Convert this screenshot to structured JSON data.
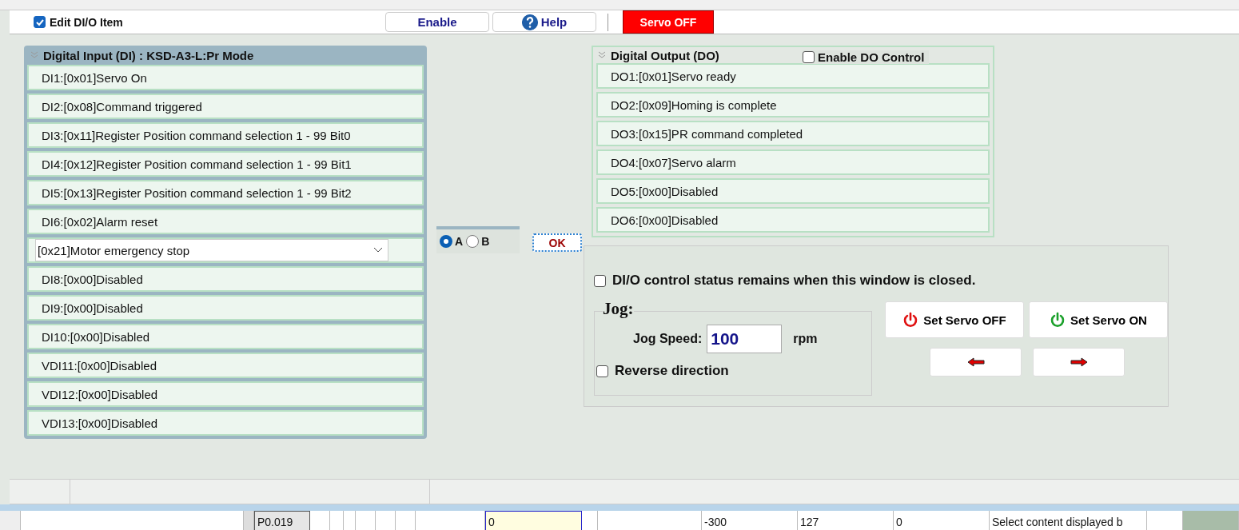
{
  "toolbar": {
    "edit_item": {
      "label": "Edit DI/O Item",
      "checked": true
    },
    "buttons": [
      {
        "label": "Enable",
        "kind": "plain"
      },
      {
        "label": "Help",
        "kind": "help"
      }
    ],
    "servo_status": "Servo OFF"
  },
  "di_panel": {
    "title": "Digital Input (DI) : KSD-A3-L:Pr Mode",
    "rows": [
      {
        "kind": "text",
        "label": "DI1:[0x01]Servo On"
      },
      {
        "kind": "text",
        "label": "DI2:[0x08]Command triggered"
      },
      {
        "kind": "text",
        "label": "DI3:[0x11]Register Position command selection 1 - 99 Bit0"
      },
      {
        "kind": "text",
        "label": "DI4:[0x12]Register Position command selection 1 - 99 Bit1"
      },
      {
        "kind": "text",
        "label": "DI5:[0x13]Register Position command selection 1 - 99 Bit2"
      },
      {
        "kind": "text",
        "label": "DI6:[0x02]Alarm reset"
      },
      {
        "kind": "select",
        "label": "[0x21]Motor emergency stop"
      },
      {
        "kind": "text",
        "label": "DI8:[0x00]Disabled"
      },
      {
        "kind": "text",
        "label": "DI9:[0x00]Disabled"
      },
      {
        "kind": "text",
        "label": "DI10:[0x00]Disabled"
      },
      {
        "kind": "text",
        "label": "VDI11:[0x00]Disabled"
      },
      {
        "kind": "text",
        "label": "VDI12:[0x00]Disabled"
      },
      {
        "kind": "text",
        "label": "VDI13:[0x00]Disabled"
      }
    ]
  },
  "polarity": {
    "options": [
      {
        "label": "A",
        "selected": true
      },
      {
        "label": "B",
        "selected": false
      }
    ]
  },
  "ok_button": "OK",
  "do_panel": {
    "title": "Digital Output (DO)",
    "enable_control": {
      "label": "Enable DO Control",
      "checked": false
    },
    "rows": [
      {
        "label": "DO1:[0x01]Servo ready"
      },
      {
        "label": "DO2:[0x09]Homing is complete"
      },
      {
        "label": "DO3:[0x15]PR command completed"
      },
      {
        "label": "DO4:[0x07]Servo alarm"
      },
      {
        "label": "DO5:[0x00]Disabled"
      },
      {
        "label": "DO6:[0x00]Disabled"
      }
    ]
  },
  "jog_panel": {
    "keep_status": {
      "label": "DI/O control status remains when this window is closed.",
      "checked": false
    },
    "title": "Jog:",
    "speed_label": "Jog Speed:",
    "speed_value": "100",
    "unit": "rpm",
    "reverse": {
      "label": "Reverse direction",
      "checked": false
    },
    "servo_buttons": [
      {
        "label": "Set Servo OFF",
        "kind": "off"
      },
      {
        "label": "Set Servo ON",
        "kind": "on"
      }
    ],
    "direction_buttons": [
      {
        "kind": "left"
      },
      {
        "kind": "right"
      }
    ]
  },
  "param_table": {
    "row": [
      {
        "kind": "id",
        "text": "P0.019"
      },
      {
        "kind": "input",
        "text": "0"
      },
      {
        "kind": "cell",
        "text": "-300"
      },
      {
        "kind": "cell",
        "text": "127"
      },
      {
        "kind": "cell",
        "text": "0"
      },
      {
        "kind": "cell",
        "text": "Select content displayed b"
      }
    ]
  }
}
